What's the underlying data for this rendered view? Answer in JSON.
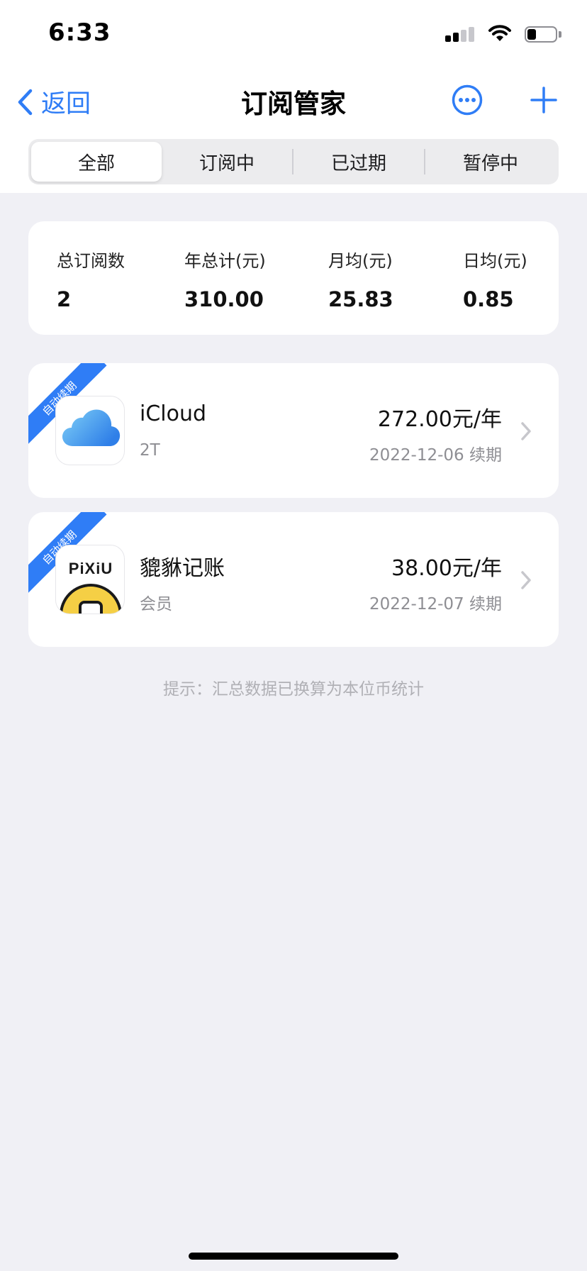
{
  "status_bar": {
    "time": "6:33"
  },
  "nav": {
    "back_label": "返回",
    "title": "订阅管家"
  },
  "tabs": [
    {
      "label": "全部",
      "selected": true
    },
    {
      "label": "订阅中",
      "selected": false
    },
    {
      "label": "已过期",
      "selected": false
    },
    {
      "label": "暂停中",
      "selected": false
    }
  ],
  "summary": {
    "total_count_label": "总订阅数",
    "total_count": "2",
    "yearly_label": "年总计(元)",
    "yearly": "310.00",
    "monthly_label": "月均(元)",
    "monthly": "25.83",
    "daily_label": "日均(元)",
    "daily": "0.85"
  },
  "subscriptions": [
    {
      "ribbon": "自动续期",
      "name": "iCloud",
      "plan": "2T",
      "price": "272.00元/年",
      "renew": "2022-12-06 续期",
      "icon": "icloud-icon"
    },
    {
      "ribbon": "自动续期",
      "name": "貔貅记账",
      "plan": "会员",
      "price": "38.00元/年",
      "renew": "2022-12-07 续期",
      "icon": "pixiu-app-icon",
      "icon_text": "PiXiU"
    }
  ],
  "tip": "提示：汇总数据已换算为本位币统计",
  "colors": {
    "accent": "#2f7df6",
    "background": "#f0f0f5",
    "card": "#ffffff"
  }
}
